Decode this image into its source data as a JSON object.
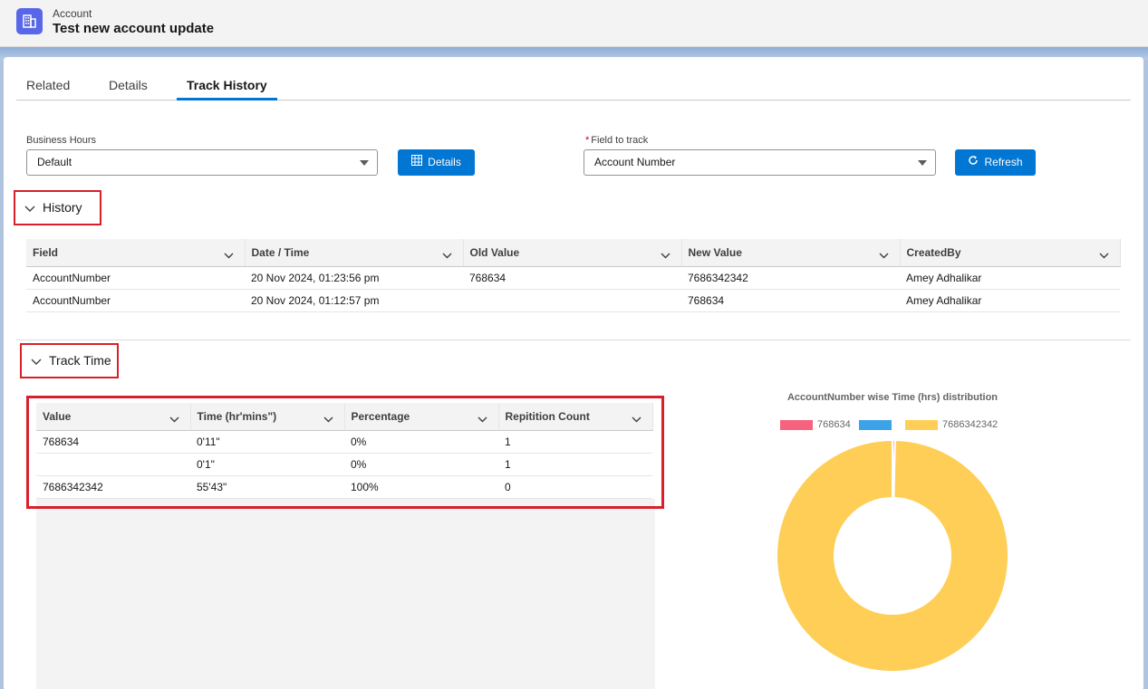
{
  "header": {
    "object_type": "Account",
    "record_title": "Test new account update"
  },
  "tabs": [
    {
      "label": "Related"
    },
    {
      "label": "Details"
    },
    {
      "label": "Track History"
    }
  ],
  "form": {
    "business_hours_label": "Business Hours",
    "business_hours_value": "Default",
    "details_button": "Details",
    "field_to_track_required": "*",
    "field_to_track_label": "Field to track",
    "field_to_track_value": "Account Number",
    "refresh_button": "Refresh"
  },
  "history": {
    "section_label": "History",
    "columns": [
      "Field",
      "Date / Time",
      "Old Value",
      "New Value",
      "CreatedBy"
    ],
    "rows": [
      [
        "AccountNumber",
        "20 Nov 2024, 01:23:56 pm",
        "768634",
        "7686342342",
        "Amey Adhalikar"
      ],
      [
        "AccountNumber",
        "20 Nov 2024, 01:12:57 pm",
        "",
        "768634",
        "Amey Adhalikar"
      ]
    ]
  },
  "track_time": {
    "section_label": "Track Time",
    "columns": [
      "Value",
      "Time (hr'mins\")",
      "Percentage",
      "Repitition Count"
    ],
    "rows": [
      [
        "768634",
        "0'11\"",
        "0%",
        "1"
      ],
      [
        "",
        "0'1\"",
        "0%",
        "1"
      ],
      [
        "7686342342",
        "55'43\"",
        "100%",
        "0"
      ]
    ]
  },
  "chart_data": {
    "type": "pie",
    "title": "AccountNumber wise Time (hrs) distribution",
    "legend": "top",
    "categories": [
      "768634",
      "",
      "7686342342"
    ],
    "values": [
      0.18,
      0.02,
      55.72
    ],
    "colors": [
      "#f7627e",
      "#3da3e8",
      "#ffce56"
    ],
    "donut": true
  },
  "colors": {
    "brand": "#0176d3",
    "highlight_box": "#d9202a",
    "object_icon": "#5867e8"
  }
}
